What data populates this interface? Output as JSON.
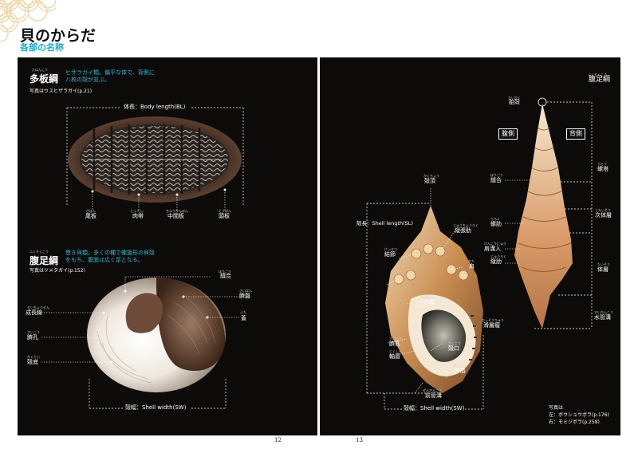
{
  "header": {
    "title": "貝のからだ",
    "subtitle": "各部の名称"
  },
  "left_page": {
    "section1": {
      "heading_ruby": "たばんこう",
      "heading": "多板綱",
      "description_line1": "ヒザラガイ類。偏平な体で、背側に",
      "description_line2": "八枚の殻が並ぶ。",
      "photo_caption": "写真はウスヒザラガイ(p.21)",
      "body_length_label": "体長：Body length(BL)",
      "labels": {
        "tail_plate": "尾板",
        "girdle": "肉帯",
        "middle_plate": "中間板",
        "head_plate": "頭板"
      },
      "rubies": {
        "tail_plate": "びばん",
        "girdle": "にくたい",
        "middle_plate": "ちゅうかんばん",
        "head_plate": "とうばん"
      }
    },
    "section2": {
      "heading_ruby": "ふくそくこう",
      "heading": "腹足綱",
      "description_line1": "巻き貝類。多くの種で螺旋形の貝殻",
      "description_line2": "をもち、腹面は広く足となる。",
      "photo_caption": "写真はツメタガイ(p.152)",
      "shell_width_label": "殻幅：Shell width(SW)",
      "labels": {
        "suture": "縫合",
        "growth_line": "成長線",
        "umbilicus": "臍孔",
        "base": "殻底",
        "umbilical_callus": "臍盤",
        "lid": "蓋"
      },
      "rubies": {
        "suture": "ほうごう",
        "growth_line": "せいちょうせん",
        "umbilicus": "さいこう",
        "base": "かくてい",
        "umbilical_callus": "さいばん",
        "lid": "ふた"
      }
    },
    "page_number": "12"
  },
  "right_page": {
    "heading_ruby": "ふくそくこう",
    "heading": "腹足綱",
    "shell_length_label": "殻長：Shell length(SL)",
    "shell_width_label": "殻幅：Shell width(SW)",
    "labels_left_shell": {
      "apex": "殻頂",
      "longitudinal_rib": "縦張肋",
      "nodule": "結節",
      "shoulder": "肩",
      "inner_lip": "内唇",
      "outer_lip_teeth": "滑層瘤",
      "umbilicus": "臍孔",
      "aperture": "殻口",
      "axis": "軸唇",
      "outer_lip": "外唇",
      "anterior_canal": "前管溝"
    },
    "rubies_left_shell": {
      "apex": "かくちょう",
      "longitudinal_rib": "じゅうちょうろく",
      "nodule": "けっせつ",
      "shoulder": "かた",
      "inner_lip": "ないしん",
      "outer_lip_teeth": "かっそうりゅう",
      "umbilicus": "さいこう",
      "aperture": "かくこう",
      "axis": "じくしん",
      "outer_lip": "がいしん",
      "anterior_canal": "ぜんかんこう"
    },
    "labels_right_shell": {
      "protoconch": "胎殻",
      "ventral": "腹側",
      "dorsal": "背側",
      "spire": "螺塔",
      "suture": "縫合",
      "penultimate_whorl": "次体層",
      "spiral_rib": "螺肋",
      "varix": "縦肋",
      "shoulder_spiral": "肩溝入",
      "body_whorl": "体層",
      "siphonal_canal": "水管溝"
    },
    "rubies_right_shell": {
      "protoconch": "たいかく",
      "spire": "らとう",
      "suture": "ほうごう",
      "penultimate_whorl": "じたいそう",
      "spiral_rib": "らろく",
      "varix": "じゅうろく",
      "shoulder_spiral": "けんこうにゅう",
      "body_whorl": "たいそう",
      "siphonal_canal": "すいかんこう"
    },
    "photo_caption_line1": "写真は",
    "photo_caption_line2": "左：ボウシュウボラ(p.176)",
    "photo_caption_line3": "右：モミジボラ(p.258)",
    "page_number": "13"
  },
  "colors": {
    "accent": "#1aa7c9",
    "page_bg": "#0d0b0a",
    "header_wave": "#e8c98c"
  }
}
